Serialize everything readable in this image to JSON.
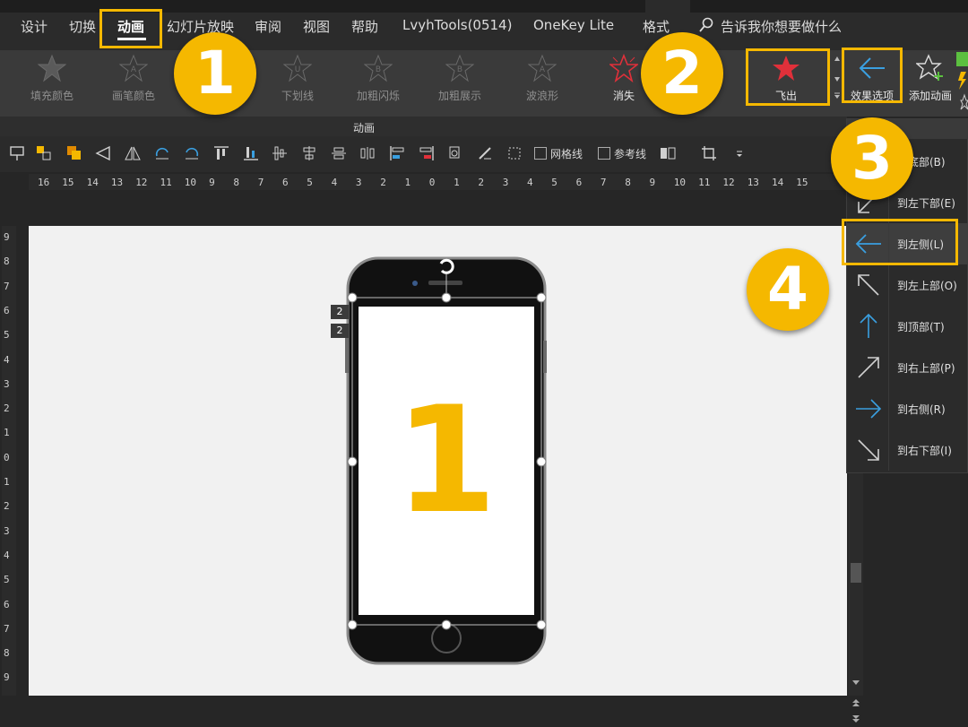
{
  "menubar": {
    "tabs": [
      {
        "label": "设计"
      },
      {
        "label": "切换"
      },
      {
        "label": "动画"
      },
      {
        "label": "幻灯片放映"
      },
      {
        "label": "审阅"
      },
      {
        "label": "视图"
      },
      {
        "label": "帮助"
      },
      {
        "label": "LvyhTools(0514)"
      },
      {
        "label": "OneKey Lite"
      },
      {
        "label": "格式"
      }
    ],
    "active_tab": "动画",
    "search_placeholder": "告诉我你想要做什么"
  },
  "ribbon": {
    "effects": [
      {
        "label": "填充颜色",
        "icon": "star-icon",
        "enabled": false
      },
      {
        "label": "画笔颜色",
        "icon": "star-a-icon",
        "enabled": false
      },
      {
        "label": "下划线",
        "icon": "star-u-icon",
        "enabled": false
      },
      {
        "label": "加粗闪烁",
        "icon": "star-b-icon",
        "enabled": false
      },
      {
        "label": "加粗展示",
        "icon": "star-b-icon",
        "enabled": false
      },
      {
        "label": "波浪形",
        "icon": "star-a-icon",
        "enabled": false
      },
      {
        "label": "消失",
        "icon": "red-star-outline-icon",
        "enabled": true
      },
      {
        "label": "飞出",
        "icon": "red-star-icon",
        "enabled": true,
        "selected": true
      }
    ],
    "effect_options_label": "效果选项",
    "add_animation_label": "添加动画",
    "group_label": "动画"
  },
  "format_toolbar": {
    "gridlines_label": "网格线",
    "guides_label": "参考线"
  },
  "rulers": {
    "horizontal": [
      "16",
      "15",
      "14",
      "13",
      "12",
      "11",
      "10",
      "9",
      "8",
      "7",
      "6",
      "5",
      "4",
      "3",
      "2",
      "1",
      "0",
      "1",
      "2",
      "3",
      "4",
      "5",
      "6",
      "7",
      "8",
      "9",
      "10",
      "11",
      "12",
      "13",
      "14",
      "15"
    ],
    "vertical": [
      "9",
      "8",
      "7",
      "6",
      "5",
      "4",
      "3",
      "2",
      "1",
      "0",
      "1",
      "2",
      "3",
      "4",
      "5",
      "6",
      "7",
      "8",
      "9"
    ]
  },
  "slide": {
    "phone_number": "1",
    "animation_tags": [
      "2",
      "2"
    ]
  },
  "direction_menu": {
    "items": [
      {
        "label": "到底部(B)",
        "icon": "arrow-down-icon"
      },
      {
        "label": "到左下部(E)",
        "icon": "arrow-down-left-icon"
      },
      {
        "label": "到左侧(L)",
        "icon": "arrow-left-icon",
        "selected": true
      },
      {
        "label": "到左上部(O)",
        "icon": "arrow-up-left-icon"
      },
      {
        "label": "到顶部(T)",
        "icon": "arrow-up-icon"
      },
      {
        "label": "到右上部(P)",
        "icon": "arrow-up-right-icon"
      },
      {
        "label": "到右侧(R)",
        "icon": "arrow-right-icon"
      },
      {
        "label": "到右下部(I)",
        "icon": "arrow-down-right-icon"
      }
    ]
  },
  "steps": [
    "1",
    "2",
    "3",
    "4"
  ],
  "colors": {
    "highlight": "#f5b800",
    "accent_blue": "#3a9fe0",
    "accent_red": "#e0303a"
  }
}
